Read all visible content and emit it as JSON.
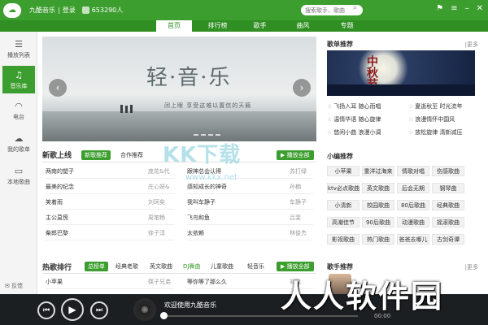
{
  "app": {
    "name": "九酷音乐",
    "login": "登录",
    "count": "653290人"
  },
  "search": {
    "placeholder": "搜索歌手、歌曲"
  },
  "nav": {
    "tabs": [
      {
        "label": "首页",
        "active": true
      },
      {
        "label": "排行榜"
      },
      {
        "label": "歌手"
      },
      {
        "label": "曲风"
      },
      {
        "label": "专题"
      }
    ]
  },
  "sidebar": {
    "items": [
      {
        "label": "播放列表",
        "icon": "playlist-icon"
      },
      {
        "label": "音乐库",
        "icon": "music-note-icon",
        "active": true
      },
      {
        "label": "电台",
        "icon": "radio-icon"
      },
      {
        "label": "我的歌单",
        "icon": "cloud-icon"
      },
      {
        "label": "本地歌曲",
        "icon": "computer-icon"
      }
    ],
    "feedback": "反馈"
  },
  "banner": {
    "title": "轻·音·乐",
    "subtitle": "闭上眼  享受这难以置信的天籁"
  },
  "new_songs": {
    "title": "新歌上线",
    "tabs": [
      "新歌推荐",
      "合作推荐"
    ],
    "play_all": "播放全部",
    "left": [
      {
        "song": "两南的塑子",
        "artist": "庞花&代"
      },
      {
        "song": "最美的纪念",
        "artist": "庄心妍&"
      },
      {
        "song": "笑着雨",
        "artist": "刘珂矣"
      },
      {
        "song": "主公莫慌",
        "artist": "周笔畅"
      },
      {
        "song": "柴郎巴黎",
        "artist": "徐子淳"
      }
    ],
    "right": [
      {
        "song": "跟神总会认得",
        "artist": "苏打绿"
      },
      {
        "song": "感知成长的神奇",
        "artist": "孙楠"
      },
      {
        "song": "我叫车静子",
        "artist": "车静子"
      },
      {
        "song": "飞鸟和鱼",
        "artist": "吕斐"
      },
      {
        "song": "太依赖",
        "artist": "林俊杰"
      }
    ]
  },
  "hot": {
    "title": "热歌排行",
    "tabs": [
      "总榜单",
      "经典老歌",
      "英文歌曲",
      "DJ舞曲",
      "儿童歌曲",
      "轻音乐"
    ],
    "play_all": "播放全部",
    "left": [
      {
        "song": "小苹果",
        "artist": "筷子兄弟"
      }
    ],
    "right": [
      {
        "song": "等你等了那么久",
        "artist": "祁隆"
      }
    ]
  },
  "playlist_rec": {
    "title": "歌单推荐",
    "more": "|更多",
    "poster_text": "中秋节",
    "items": [
      [
        "飞扬入耳 随心而唱",
        "夏逝秋至 时光流年"
      ],
      [
        "温情华语 随心旋律",
        "浪漫情怀中国风"
      ],
      [
        "悠闲小曲 浪漫小调",
        "放松旋律 清新减压"
      ]
    ]
  },
  "editor_rec": {
    "title": "小编推荐",
    "chips": [
      [
        "小苹果",
        "重洋过海来",
        "情歌对唱",
        "伤感歌曲"
      ],
      [
        "ktv必点歌曲",
        "英文歌曲",
        "后会无期",
        "钢琴曲"
      ],
      [
        "小清新",
        "校园歌曲",
        "80后歌曲",
        "经典歌曲"
      ],
      [
        "高潮佳节",
        "90后歌曲",
        "动漫歌曲",
        "摇滚歌曲"
      ],
      [
        "影视歌曲",
        "热门歌曲",
        "爸爸去哪儿",
        "古剑奇谭"
      ]
    ]
  },
  "singer_rec": {
    "title": "歌手推荐",
    "more": "|更多"
  },
  "player": {
    "now_playing": "欢迎使用九酷音乐",
    "time": "00:00"
  },
  "watermarks": {
    "kk": "KK下载",
    "url": "www.kkx.net",
    "rr": "人人软件园"
  }
}
